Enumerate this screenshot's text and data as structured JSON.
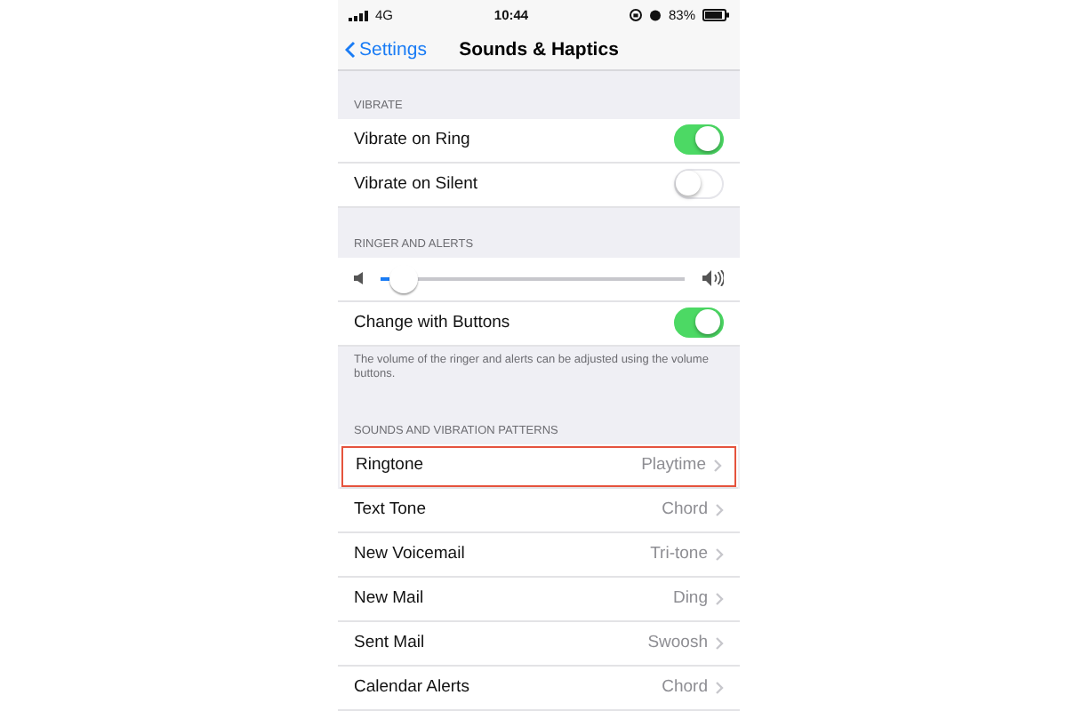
{
  "status_bar": {
    "network": "4G",
    "time": "10:44",
    "battery": "83%"
  },
  "nav": {
    "back": "Settings",
    "title": "Sounds & Haptics"
  },
  "sections": [
    {
      "header": "VIBRATE",
      "rows": [
        {
          "kind": "toggle",
          "label": "Vibrate on Ring",
          "on": true
        },
        {
          "kind": "toggle",
          "label": "Vibrate on Silent",
          "on": false
        }
      ]
    },
    {
      "header": "RINGER AND ALERTS",
      "rows": [
        {
          "kind": "slider",
          "level": 0.03
        },
        {
          "kind": "toggle",
          "label": "Change with Buttons",
          "on": true
        }
      ],
      "footer": "The volume of the ringer and alerts can be adjusted using the volume buttons."
    },
    {
      "header": "SOUNDS AND VIBRATION PATTERNS",
      "rows": [
        {
          "kind": "link",
          "label": "Ringtone",
          "value": "Playtime",
          "highlighted": true
        },
        {
          "kind": "link",
          "label": "Text Tone",
          "value": "Chord",
          "highlighted": false
        },
        {
          "kind": "link",
          "label": "New Voicemail",
          "value": "Tri-tone",
          "highlighted": false
        },
        {
          "kind": "link",
          "label": "New Mail",
          "value": "Ding",
          "highlighted": false
        },
        {
          "kind": "link",
          "label": "Sent Mail",
          "value": "Swoosh",
          "highlighted": false
        },
        {
          "kind": "link",
          "label": "Calendar Alerts",
          "value": "Chord",
          "highlighted": false
        }
      ]
    }
  ]
}
